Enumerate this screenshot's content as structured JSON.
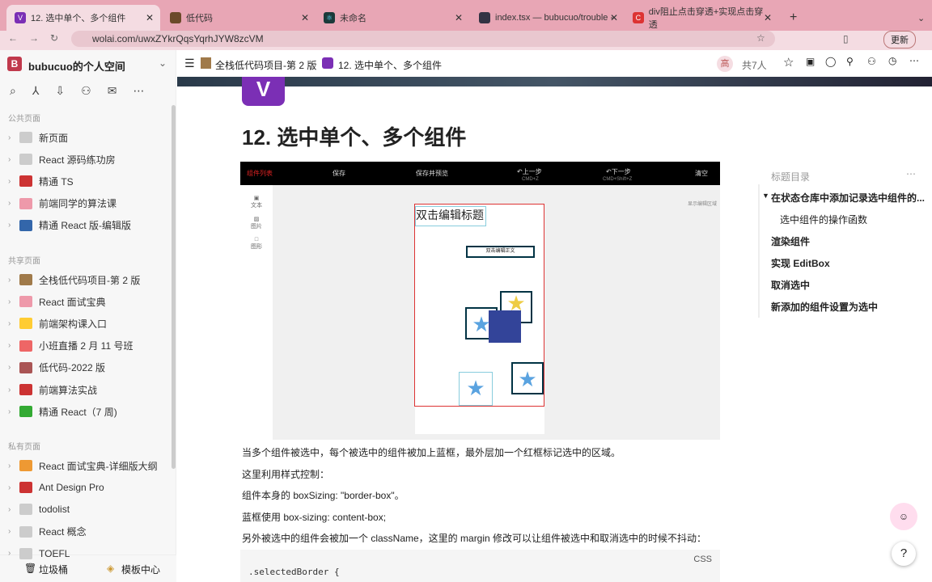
{
  "browser": {
    "tabs": [
      {
        "label": "12. 选中单个、多个组件",
        "icon": "V"
      },
      {
        "label": "低代码",
        "icon": "•"
      },
      {
        "label": "未命名",
        "icon": "⚛"
      },
      {
        "label": "index.tsx — bubucuo/trouble -",
        "icon": "●"
      },
      {
        "label": "div阻止点击穿透+实现点击穿透",
        "icon": "C"
      }
    ],
    "new_tab": "+",
    "url": "wolai.com/uwxZYkrQqsYqrhJYW8zcVM",
    "update_btn": "更新"
  },
  "workspace": {
    "name": "bubucuo的个人空间",
    "avatar": "B"
  },
  "breadcrumb": {
    "menu": "☰",
    "parent": "全栈低代码项目-第 2 版",
    "current": "12. 选中单个、多个组件"
  },
  "header": {
    "presence": "高",
    "members": "共7人"
  },
  "sidebar": {
    "public_title": "公共页面",
    "public": [
      "新页面",
      "React 源码练功房",
      "精通 TS",
      "前端同学的算法课",
      "精通 React 版-编辑版"
    ],
    "shared_title": "共享页面",
    "shared": [
      "全栈低代码项目-第 2 版",
      "React 面试宝典",
      "前端架构课入口",
      "小班直播 2 月 11 号班",
      "低代码-2022 版",
      "前端算法实战",
      "精通 React（7 周)"
    ],
    "private_title": "私有页面",
    "private": [
      "React 面试宝典-详细版大纲",
      "Ant Design Pro",
      "todolist",
      "React 概念",
      "TOEFL"
    ],
    "trash": "垃圾桶",
    "templates": "模板中心"
  },
  "page": {
    "title": "12. 选中单个、多个组件",
    "editor": {
      "list": "组件列表",
      "save": "保存",
      "save_preview": "保存并预览",
      "undo": "上一步",
      "undo_key": "CMD+Z",
      "redo": "下一步",
      "redo_key": "CMD+Shift+Z",
      "clear": "清空",
      "side": [
        "文本",
        "图片",
        "图形"
      ],
      "hint": "显示编辑区域",
      "title_text": "双击编辑标题",
      "body_text": "双击编辑正文"
    },
    "paragraphs": [
      "当多个组件被选中，每个被选中的组件被加上蓝框，最外层加一个红框标记选中的区域。",
      "这里利用样式控制：",
      "组件本身的 boxSizing: \"border-box\"。",
      "蓝框使用 box-sizing: content-box;",
      "另外被选中的组件会被加一个 className，这里的 margin 修改可以让组件被选中和取消选中的时候不抖动："
    ],
    "code": {
      "lang": "CSS",
      "line1": ".selectedBorder {"
    }
  },
  "toc": {
    "title": "标题目录",
    "items": [
      "在状态仓库中添加记录选中组件的...",
      "选中组件的操作函数",
      "渲染组件",
      "实现 EditBox",
      "取消选中",
      "新添加的组件设置为选中"
    ]
  },
  "help": "?"
}
